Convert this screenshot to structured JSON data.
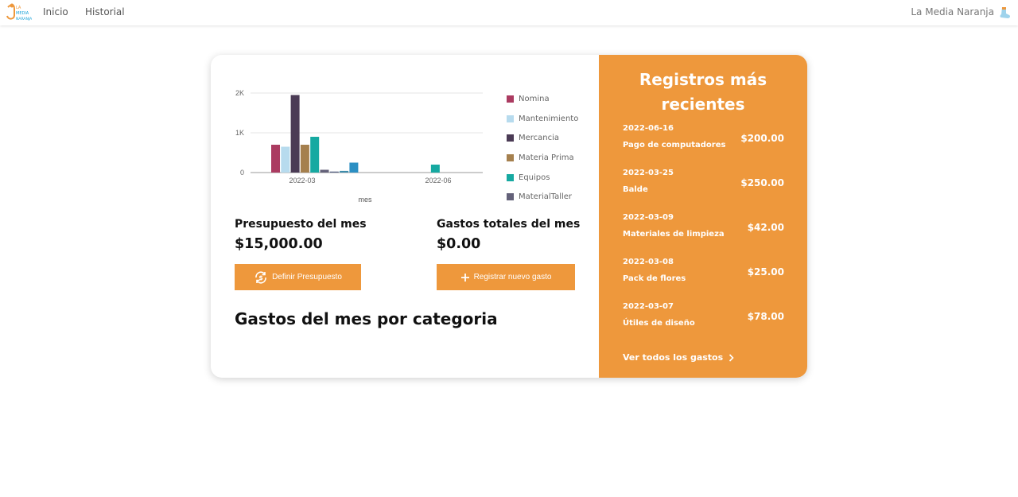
{
  "nav": {
    "logo_text": "LA MEDIA NARANJA",
    "links": [
      "Inicio",
      "Historial"
    ],
    "brand": "La Media Naranja"
  },
  "summary": {
    "budget_title": "Presupuesto del mes",
    "budget_value": "$15,000.00",
    "budget_button": "Definir Presupuesto",
    "expenses_title": "Gastos totales del mes",
    "expenses_value": "$0.00",
    "expenses_button": "Registrar nuevo gasto",
    "category_heading": "Gastos del mes por categoria"
  },
  "chart_data": {
    "type": "bar",
    "categories": [
      "2022-03",
      "2022-06"
    ],
    "xlabel": "mes",
    "ylabel": "",
    "yticks": [
      "0",
      "1K",
      "2K"
    ],
    "ylim": [
      0,
      2100
    ],
    "grid": true,
    "legend_position": "right",
    "series": [
      {
        "name": "Nomina",
        "color": "#ab3b61",
        "values": [
          700,
          0
        ]
      },
      {
        "name": "Mantenimiento",
        "color": "#b7dbee",
        "values": [
          650,
          0
        ]
      },
      {
        "name": "Mercancia",
        "color": "#4b3b55",
        "values": [
          1950,
          0
        ]
      },
      {
        "name": "Materia Prima",
        "color": "#a5804e",
        "values": [
          700,
          0
        ]
      },
      {
        "name": "Equipos",
        "color": "#16a9a1",
        "values": [
          900,
          200
        ]
      },
      {
        "name": "MaterialTaller",
        "color": "#636179",
        "values": [
          70,
          0
        ]
      },
      {
        "name": "",
        "color": "#566083",
        "values": [
          25,
          0
        ]
      },
      {
        "name": "",
        "color": "#3e8cab",
        "values": [
          42,
          0
        ]
      },
      {
        "name": "",
        "color": "#2b8fc3",
        "values": [
          250,
          0
        ]
      }
    ]
  },
  "recent": {
    "title": "Registros más recientes",
    "items": [
      {
        "date": "2022-06-16",
        "desc": "Pago de computadores",
        "amount": "$200.00"
      },
      {
        "date": "2022-03-25",
        "desc": "Balde",
        "amount": "$250.00"
      },
      {
        "date": "2022-03-09",
        "desc": "Materiales de limpieza",
        "amount": "$42.00"
      },
      {
        "date": "2022-03-08",
        "desc": "Pack de flores",
        "amount": "$25.00"
      },
      {
        "date": "2022-03-07",
        "desc": "Útiles de diseño",
        "amount": "$78.00"
      }
    ],
    "view_all": "Ver todos los gastos"
  },
  "colors": {
    "accent": "#ee983c"
  }
}
